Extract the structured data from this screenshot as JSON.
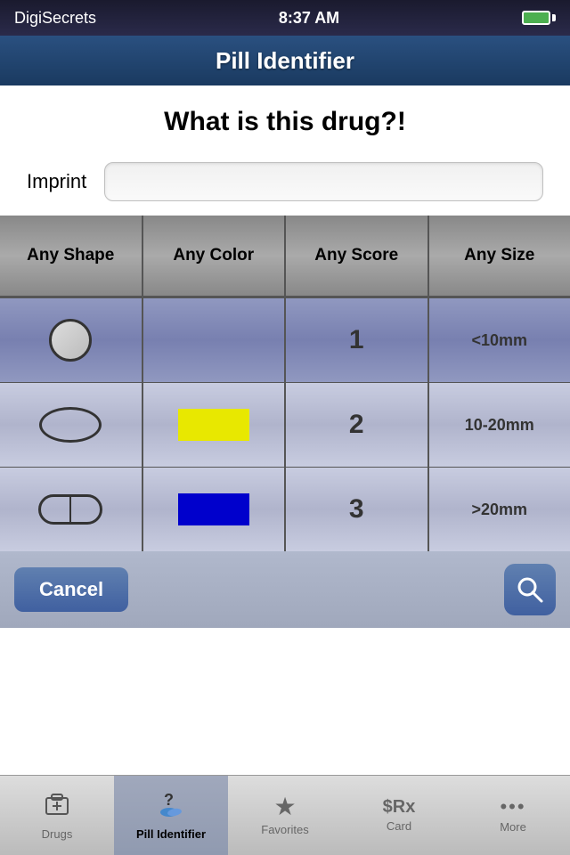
{
  "statusBar": {
    "appName": "DigiSecrets",
    "time": "8:37 AM"
  },
  "header": {
    "title": "Pill Identifier"
  },
  "main": {
    "question": "What is this drug?!",
    "imprint": {
      "label": "Imprint",
      "placeholder": ""
    }
  },
  "picker": {
    "columns": [
      {
        "header": "Any Shape"
      },
      {
        "header": "Any Color"
      },
      {
        "header": "Any Score"
      },
      {
        "header": "Any Size"
      }
    ],
    "rows": [
      {
        "shape": "circle",
        "colorClass": "",
        "colorLabel": "",
        "score": "1",
        "size": "<10mm",
        "selected": true
      },
      {
        "shape": "oval",
        "colorClass": "color-yellow",
        "colorLabel": "Yellow",
        "score": "2",
        "size": "10-20mm",
        "selected": false
      },
      {
        "shape": "capsule",
        "colorClass": "color-blue",
        "colorLabel": "Blue",
        "score": "3",
        "size": ">20mm",
        "selected": false
      }
    ]
  },
  "buttons": {
    "cancel": "Cancel",
    "search": "Search"
  },
  "tabs": [
    {
      "id": "drugs",
      "label": "Drugs",
      "icon": "💊",
      "active": false
    },
    {
      "id": "pill-identifier",
      "label": "Pill Identifier",
      "icon": "❓",
      "active": true
    },
    {
      "id": "favorites",
      "label": "Favorites",
      "icon": "★",
      "active": false
    },
    {
      "id": "card",
      "label": "Card",
      "icon": "$Rx",
      "active": false
    },
    {
      "id": "more",
      "label": "More",
      "icon": "•••",
      "active": false
    }
  ]
}
